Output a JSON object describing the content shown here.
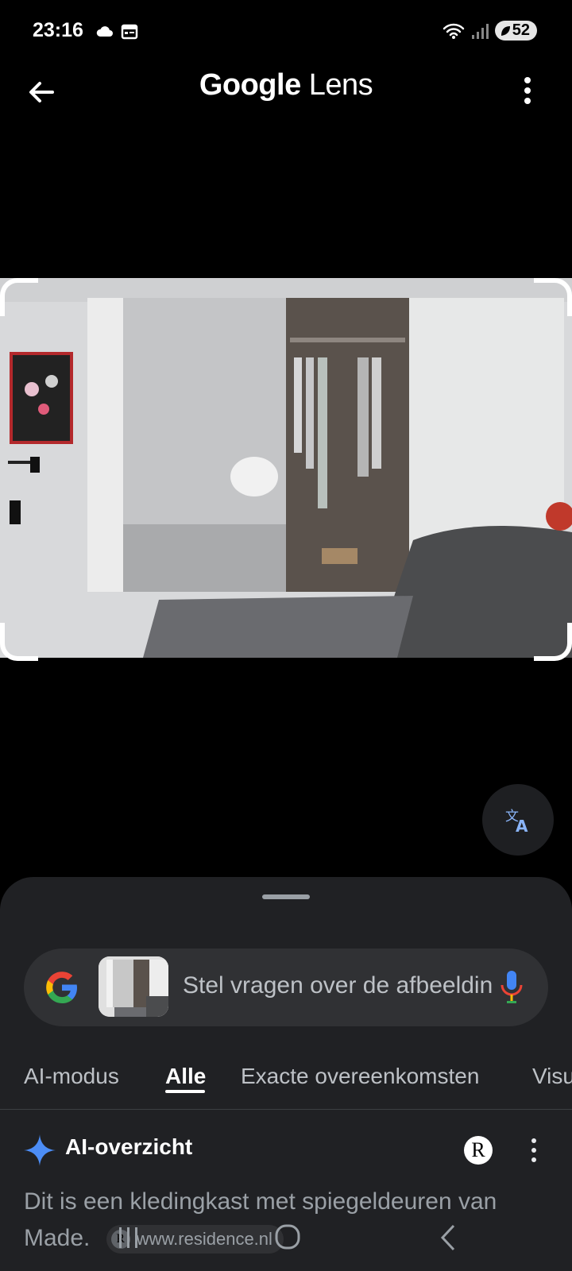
{
  "status": {
    "time": "23:16",
    "battery": "52"
  },
  "app": {
    "title_google": "Google",
    "title_lens": "Lens"
  },
  "search": {
    "placeholder": "Stel vragen over de afbeelding"
  },
  "tabs": [
    {
      "label": "AI-modus"
    },
    {
      "label": "Alle"
    },
    {
      "label": "Exacte overeenkomsten"
    },
    {
      "label": "Visu"
    }
  ],
  "ai": {
    "title": "AI-overzicht",
    "source_initial": "R",
    "summary": "Dit is een kledingkast met spiegeldeuren van Made.",
    "chip_text": "www.residence.nl"
  },
  "colors": {
    "sheet": "#202124",
    "search_box": "#303134",
    "accent_blue": "#4285F4"
  }
}
